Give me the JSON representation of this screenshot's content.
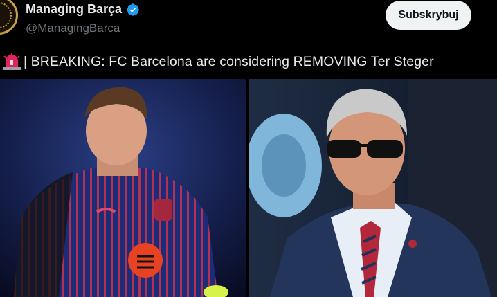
{
  "account": {
    "name": "Managing Barça",
    "handle": "@ManagingBarca",
    "verified": true
  },
  "actions": {
    "subscribe_label": "Subskrybuj"
  },
  "tweet": {
    "prefix_icon": "siren-icon",
    "text": "| BREAKING: FC Barcelona are considering REMOVING Ter Steger"
  },
  "colors": {
    "background": "#000000",
    "text_primary": "#e7e9ea",
    "text_secondary": "#71767b",
    "verified_blue": "#1d9bf0",
    "button_bg": "#eff3f4",
    "siren_red": "#e0245e"
  },
  "media": {
    "images": [
      {
        "icon": "goalkeeper-photo"
      },
      {
        "icon": "president-photo"
      }
    ]
  }
}
